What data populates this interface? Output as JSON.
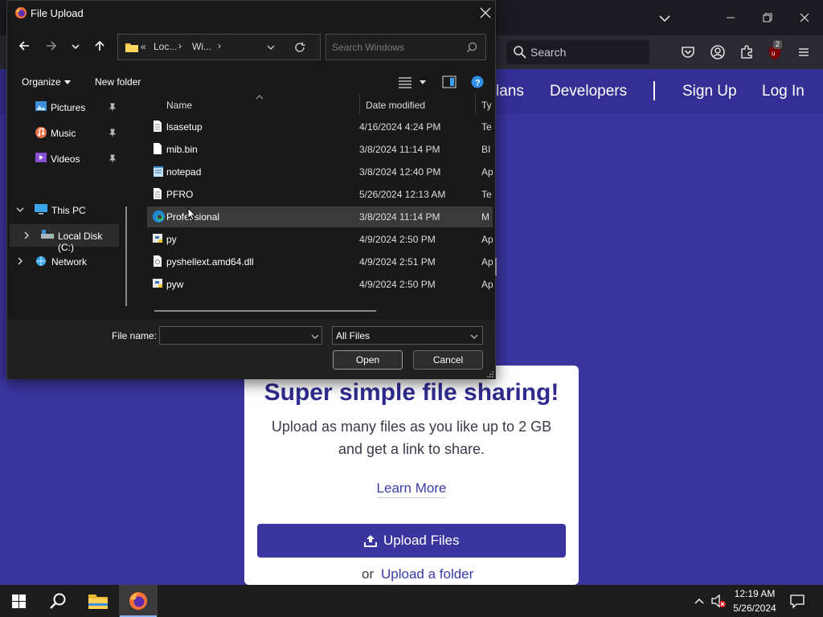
{
  "browser": {
    "search_label": "Search"
  },
  "site": {
    "nav": [
      "lans",
      "Developers",
      "Sign Up",
      "Log In"
    ],
    "card": {
      "title": "Super simple file sharing!",
      "desc_line1": "Upload as many files as you like up to 2 GB",
      "desc_line2": "and get a link to share.",
      "learn_more": "Learn More",
      "upload_files": "Upload Files",
      "or": "or",
      "upload_folder": "Upload a folder"
    },
    "colors": {
      "brand": "#3b35a0",
      "link": "#3b3aa6"
    }
  },
  "dialog": {
    "title": "File Upload",
    "address": {
      "seg1": "Loc...",
      "seg2": "Wi...",
      "chevrons": "«",
      "sep": "›"
    },
    "search_placeholder": "Search Windows",
    "organize": "Organize",
    "new_folder": "New folder",
    "nav_items": [
      {
        "label": "Pictures",
        "icon": "pictures-icon",
        "pinned": true
      },
      {
        "label": "Music",
        "icon": "music-icon",
        "pinned": true
      },
      {
        "label": "Videos",
        "icon": "videos-icon",
        "pinned": true
      },
      {
        "label": "This PC",
        "icon": "computer-icon",
        "expanded": true
      },
      {
        "label": "Local Disk (C:)",
        "icon": "drive-icon",
        "selected": true
      },
      {
        "label": "Network",
        "icon": "network-icon"
      }
    ],
    "columns": {
      "name": "Name",
      "date": "Date modified",
      "type": "Ty"
    },
    "files": [
      {
        "name": "lsasetup",
        "date": "4/16/2024 4:24 PM",
        "type": "Te",
        "icon": "text-file-icon"
      },
      {
        "name": "mib.bin",
        "date": "3/8/2024 11:14 PM",
        "type": "BI",
        "icon": "file-icon"
      },
      {
        "name": "notepad",
        "date": "3/8/2024 12:40 PM",
        "type": "Ap",
        "icon": "notepad-icon"
      },
      {
        "name": "PFRO",
        "date": "5/26/2024 12:13 AM",
        "type": "Te",
        "icon": "text-file-icon"
      },
      {
        "name": "Professional",
        "date": "3/8/2024 11:14 PM",
        "type": "M",
        "icon": "edge-icon",
        "selected": true
      },
      {
        "name": "py",
        "date": "4/9/2024 2:50 PM",
        "type": "Ap",
        "icon": "python-icon"
      },
      {
        "name": "pyshellext.amd64.dll",
        "date": "4/9/2024 2:51 PM",
        "type": "Ap",
        "icon": "dll-icon"
      },
      {
        "name": "pyw",
        "date": "4/9/2024 2:50 PM",
        "type": "Ap",
        "icon": "python-icon"
      }
    ],
    "filename_label": "File name:",
    "filename_value": "",
    "filter": "All Files",
    "open": "Open",
    "cancel": "Cancel"
  },
  "taskbar": {
    "time": "12:19 AM",
    "date": "5/26/2024"
  }
}
